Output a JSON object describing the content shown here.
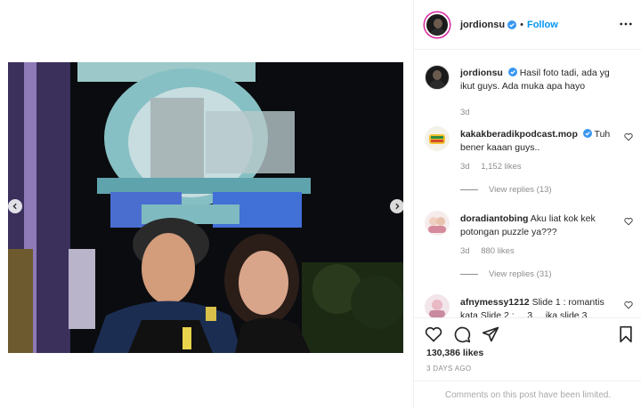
{
  "post": {
    "username": "jordionsu",
    "follow_label": "Follow",
    "dot": "•"
  },
  "caption": {
    "username": "jordionsu",
    "text": "Hasil foto tadi, ada yg ikut guys. Ada muka apa hayo",
    "time": "3d"
  },
  "comments": [
    {
      "username": "kakakberadikpodcast.mop",
      "verified": true,
      "text": "Tuh bener kaaan guys..",
      "time": "3d",
      "likes": "1,152 likes",
      "replies": "View replies (13)"
    },
    {
      "username": "doradiantobing",
      "verified": false,
      "text": "Aku liat kok kek potongan puzzle ya???",
      "time": "3d",
      "likes": "880 likes",
      "replies": "View replies (31)"
    },
    {
      "username": "afnymessy1212",
      "verified": false,
      "text": "Slide 1 : romantis kata Slide 2 : ... 3 ... ika slide 3"
    }
  ],
  "stats": {
    "likes": "130,386 likes",
    "date": "3 DAYS AGO"
  },
  "footer": {
    "limited": "Comments on this post have been limited."
  },
  "colors": {
    "link_blue": "#0095f6",
    "verified_blue": "#3897f0",
    "muted": "#8e8e8e"
  },
  "icons": [
    "verified-badge-icon",
    "more-options-icon",
    "heart-icon",
    "comment-icon",
    "share-icon",
    "bookmark-icon",
    "chevron-left-icon",
    "chevron-right-icon"
  ]
}
